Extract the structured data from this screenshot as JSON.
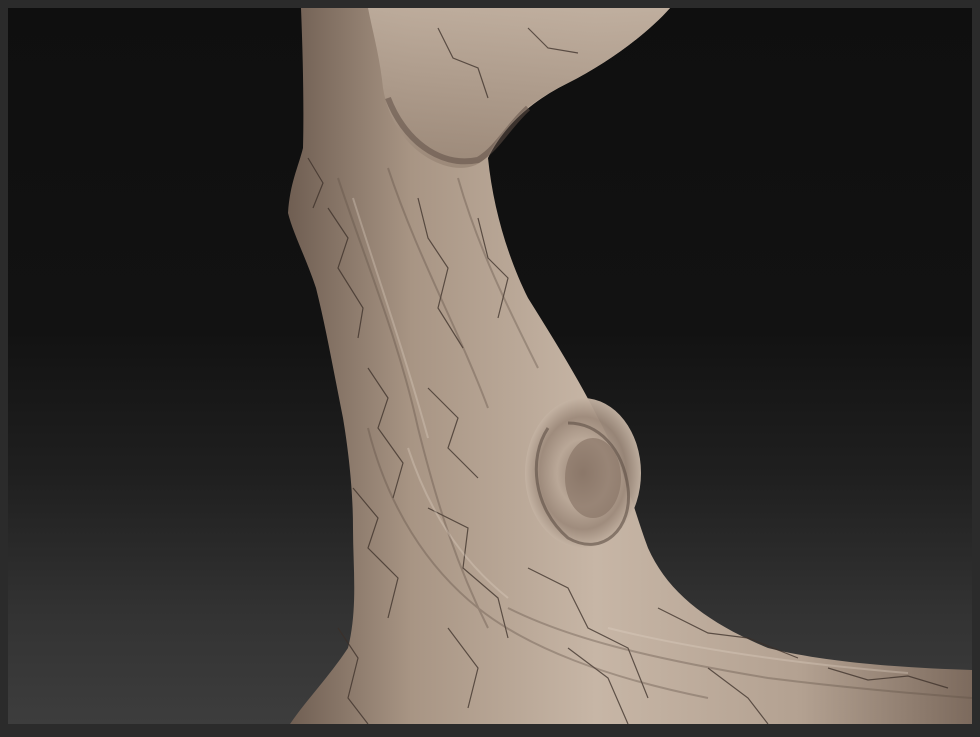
{
  "scene": {
    "subject": "sculpted-tree-trunk",
    "colors": {
      "frame": "#2b2b2b",
      "bg_top": "#0f0f0f",
      "bg_bottom": "#3d3d3d",
      "material_light": "#c7b6a6",
      "material_mid": "#a89584",
      "material_dark": "#6f5e52",
      "crack": "#3b2f28"
    }
  }
}
